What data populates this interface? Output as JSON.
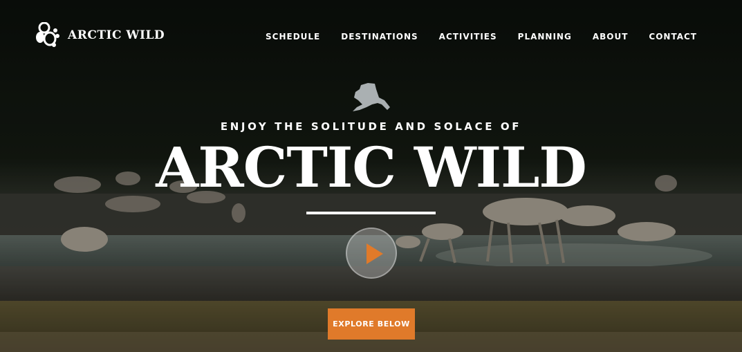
{
  "brand": {
    "name": "ARCTIC WILD",
    "logo_icon": "bear-paw-logo-icon"
  },
  "nav": {
    "items": [
      {
        "label": "SCHEDULE"
      },
      {
        "label": "DESTINATIONS"
      },
      {
        "label": "ACTIVITIES"
      },
      {
        "label": "PLANNING"
      },
      {
        "label": "ABOUT"
      },
      {
        "label": "CONTACT"
      }
    ]
  },
  "hero": {
    "map_icon": "alaska-map-icon",
    "tagline": "ENJOY THE SOLITUDE AND SOLACE OF",
    "title": "ARCTIC WILD",
    "play_icon": "play-icon",
    "cta_label": "EXPLORE BELOW"
  },
  "colors": {
    "accent": "#e07a2a",
    "text": "#ffffff",
    "background_dark": "#0e120c"
  }
}
